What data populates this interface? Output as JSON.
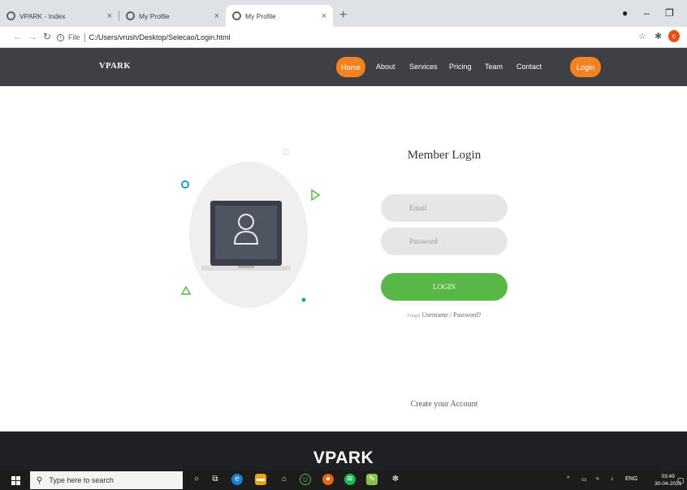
{
  "browser": {
    "tabs": [
      {
        "title": "VPARK - Index",
        "close": "×"
      },
      {
        "title": "My Profile",
        "close": "×"
      },
      {
        "title": "My Profile",
        "close": "×"
      }
    ],
    "new_tab": "+",
    "address": {
      "scheme": "File",
      "path": "C:/Users/vrush/Desktop/Selecao/Login.html"
    }
  },
  "site": {
    "brand": "VPARK",
    "nav": [
      "Home",
      "About",
      "Services",
      "Pricing",
      "Team",
      "Contact"
    ],
    "nav_active": "Home",
    "login_button": "Login",
    "accent_color": "#f58220",
    "header_bg": "#3f3f46"
  },
  "login": {
    "title": "Member Login",
    "email_placeholder": "Email",
    "password_placeholder": "Password",
    "submit": "LOGIN",
    "button_color": "#57b846",
    "forgot_prefix": "Forgot",
    "forgot_link": "Username / Password?",
    "create_account": "Create your Account"
  },
  "footer": {
    "brand": "VPARK",
    "bg": "#1f2024"
  },
  "taskbar": {
    "search_placeholder": "Type here to search",
    "lang": "ENG",
    "time": "03:49",
    "date": "30-04-2021"
  }
}
